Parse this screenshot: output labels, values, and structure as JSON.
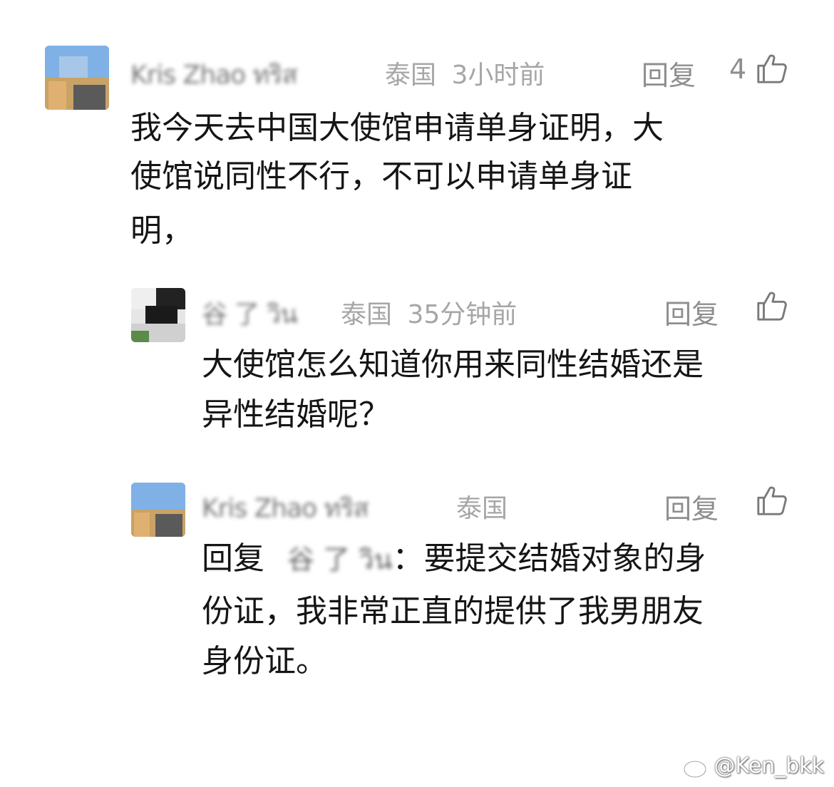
{
  "comments": [
    {
      "user_name": "Kris Zhao ทริส",
      "location": "泰国",
      "time": "3小时前",
      "reply_label": "回复",
      "like_count": "4",
      "text_lines": [
        "我今天去中国大使馆申请单身证明，大",
        "使馆说同性不行，不可以申请单身证",
        "明，"
      ]
    },
    {
      "user_name": "谷 了 วิน",
      "location": "泰国",
      "time": "35分钟前",
      "reply_label": "回复",
      "text_lines": [
        "大使馆怎么知道你用来同性结婚还是",
        "异性结婚呢？"
      ]
    },
    {
      "user_name": "Kris Zhao ทริส",
      "location": "泰国",
      "reply_label": "回复",
      "reply_prefix": "回复",
      "reply_target": "谷 了 วิน",
      "text_lines": [
        "：要提交结婚对象的身",
        "份证，我非常正直的提供了我男朋友",
        "身份证。"
      ]
    }
  ],
  "watermark": {
    "text": "@Ken_bkk",
    "icon": "weibo-icon"
  },
  "icons": {
    "like": "thumbs-up-icon"
  }
}
